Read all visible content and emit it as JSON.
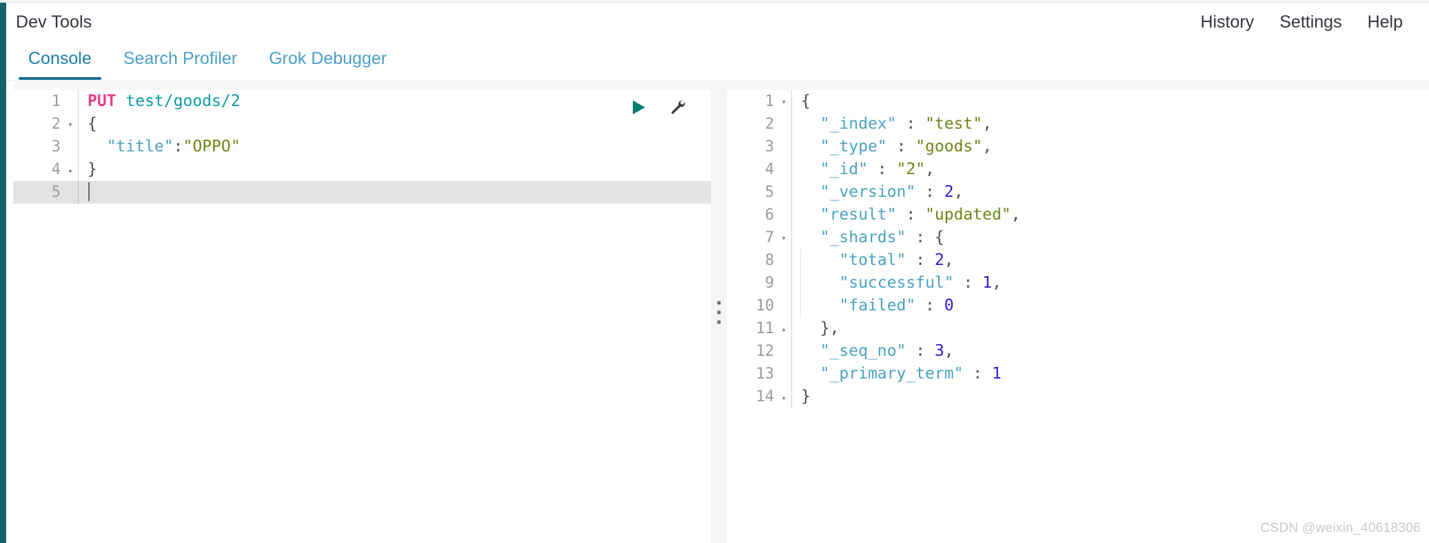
{
  "header": {
    "title": "Dev Tools",
    "links": [
      {
        "label": "History",
        "name": "history-link"
      },
      {
        "label": "Settings",
        "name": "settings-link"
      },
      {
        "label": "Help",
        "name": "help-link"
      }
    ]
  },
  "tabs": [
    {
      "label": "Console",
      "active": true
    },
    {
      "label": "Search Profiler",
      "active": false
    },
    {
      "label": "Grok Debugger",
      "active": false
    }
  ],
  "colors": {
    "rail": "#14606c",
    "accent": "#1b6e8d",
    "tab_active_text": "#1b7faa",
    "tab_text": "#4a9fc7",
    "method": "#e7408a",
    "url": "#0f9aa6",
    "key": "#4aa3c2",
    "string": "#6d8715",
    "number": "#2a1ad1",
    "current_line": "#e3e3e3"
  },
  "editor": {
    "name": "request-editor",
    "actions": [
      {
        "name": "run-request-button",
        "icon": "play-icon",
        "title": "Click to send request"
      },
      {
        "name": "request-options-button",
        "icon": "wrench-icon",
        "title": "Request options"
      }
    ],
    "lines": [
      {
        "number": "1",
        "fold": "",
        "current": false,
        "tokens": [
          {
            "text": "PUT ",
            "cls": "t-method"
          },
          {
            "text": "test/goods/2",
            "cls": "t-url"
          }
        ]
      },
      {
        "number": "2",
        "fold": "▾",
        "current": false,
        "tokens": [
          {
            "text": "{",
            "cls": "t-brace"
          }
        ]
      },
      {
        "number": "3",
        "fold": "",
        "current": false,
        "tokens": [
          {
            "text": "  ",
            "cls": "t-punct"
          },
          {
            "text": "\"title\"",
            "cls": "t-key"
          },
          {
            "text": ":",
            "cls": "t-punct"
          },
          {
            "text": "\"OPPO\"",
            "cls": "t-string"
          }
        ]
      },
      {
        "number": "4",
        "fold": "▴",
        "current": false,
        "tokens": [
          {
            "text": "}",
            "cls": "t-brace"
          }
        ]
      },
      {
        "number": "5",
        "fold": "",
        "current": true,
        "caret": true,
        "tokens": []
      }
    ]
  },
  "output": {
    "name": "response-viewer",
    "lines": [
      {
        "number": "1",
        "fold": "▾",
        "current": false,
        "tokens": [
          {
            "text": "{",
            "cls": "t-brace"
          }
        ]
      },
      {
        "number": "2",
        "fold": "",
        "current": false,
        "tokens": [
          {
            "text": "  ",
            "cls": "t-punct"
          },
          {
            "text": "\"_index\"",
            "cls": "t-key"
          },
          {
            "text": " : ",
            "cls": "t-punct"
          },
          {
            "text": "\"test\"",
            "cls": "t-string"
          },
          {
            "text": ",",
            "cls": "t-punct"
          }
        ]
      },
      {
        "number": "3",
        "fold": "",
        "current": false,
        "tokens": [
          {
            "text": "  ",
            "cls": "t-punct"
          },
          {
            "text": "\"_type\"",
            "cls": "t-key"
          },
          {
            "text": " : ",
            "cls": "t-punct"
          },
          {
            "text": "\"goods\"",
            "cls": "t-string"
          },
          {
            "text": ",",
            "cls": "t-punct"
          }
        ]
      },
      {
        "number": "4",
        "fold": "",
        "current": false,
        "tokens": [
          {
            "text": "  ",
            "cls": "t-punct"
          },
          {
            "text": "\"_id\"",
            "cls": "t-key"
          },
          {
            "text": " : ",
            "cls": "t-punct"
          },
          {
            "text": "\"2\"",
            "cls": "t-string"
          },
          {
            "text": ",",
            "cls": "t-punct"
          }
        ]
      },
      {
        "number": "5",
        "fold": "",
        "current": false,
        "tokens": [
          {
            "text": "  ",
            "cls": "t-punct"
          },
          {
            "text": "\"_version\"",
            "cls": "t-key"
          },
          {
            "text": " : ",
            "cls": "t-punct"
          },
          {
            "text": "2",
            "cls": "t-num"
          },
          {
            "text": ",",
            "cls": "t-punct"
          }
        ]
      },
      {
        "number": "6",
        "fold": "",
        "current": false,
        "tokens": [
          {
            "text": "  ",
            "cls": "t-punct"
          },
          {
            "text": "\"result\"",
            "cls": "t-key"
          },
          {
            "text": " : ",
            "cls": "t-punct"
          },
          {
            "text": "\"updated\"",
            "cls": "t-string"
          },
          {
            "text": ",",
            "cls": "t-punct"
          }
        ]
      },
      {
        "number": "7",
        "fold": "▾",
        "current": false,
        "tokens": [
          {
            "text": "  ",
            "cls": "t-punct"
          },
          {
            "text": "\"_shards\"",
            "cls": "t-key"
          },
          {
            "text": " : ",
            "cls": "t-punct"
          },
          {
            "text": "{",
            "cls": "t-brace"
          }
        ]
      },
      {
        "number": "8",
        "fold": "",
        "current": false,
        "tokens": [
          {
            "text": "    ",
            "cls": "t-punct"
          },
          {
            "text": "\"total\"",
            "cls": "t-key"
          },
          {
            "text": " : ",
            "cls": "t-punct"
          },
          {
            "text": "2",
            "cls": "t-num"
          },
          {
            "text": ",",
            "cls": "t-punct"
          }
        ]
      },
      {
        "number": "9",
        "fold": "",
        "current": false,
        "tokens": [
          {
            "text": "    ",
            "cls": "t-punct"
          },
          {
            "text": "\"successful\"",
            "cls": "t-key"
          },
          {
            "text": " : ",
            "cls": "t-punct"
          },
          {
            "text": "1",
            "cls": "t-num"
          },
          {
            "text": ",",
            "cls": "t-punct"
          }
        ]
      },
      {
        "number": "10",
        "fold": "",
        "current": false,
        "tokens": [
          {
            "text": "    ",
            "cls": "t-punct"
          },
          {
            "text": "\"failed\"",
            "cls": "t-key"
          },
          {
            "text": " : ",
            "cls": "t-punct"
          },
          {
            "text": "0",
            "cls": "t-num"
          }
        ]
      },
      {
        "number": "11",
        "fold": "▴",
        "current": false,
        "tokens": [
          {
            "text": "  ",
            "cls": "t-punct"
          },
          {
            "text": "}",
            "cls": "t-brace"
          },
          {
            "text": ",",
            "cls": "t-punct"
          }
        ]
      },
      {
        "number": "12",
        "fold": "",
        "current": false,
        "tokens": [
          {
            "text": "  ",
            "cls": "t-punct"
          },
          {
            "text": "\"_seq_no\"",
            "cls": "t-key"
          },
          {
            "text": " : ",
            "cls": "t-punct"
          },
          {
            "text": "3",
            "cls": "t-num"
          },
          {
            "text": ",",
            "cls": "t-punct"
          }
        ]
      },
      {
        "number": "13",
        "fold": "",
        "current": false,
        "tokens": [
          {
            "text": "  ",
            "cls": "t-punct"
          },
          {
            "text": "\"_primary_term\"",
            "cls": "t-key"
          },
          {
            "text": " : ",
            "cls": "t-punct"
          },
          {
            "text": "1",
            "cls": "t-num"
          }
        ]
      },
      {
        "number": "14",
        "fold": "▴",
        "current": false,
        "tokens": [
          {
            "text": "}",
            "cls": "t-brace"
          }
        ]
      }
    ]
  },
  "splitter": {
    "name": "pane-splitter",
    "dots": 3
  },
  "watermark": "CSDN @weixin_40618306"
}
